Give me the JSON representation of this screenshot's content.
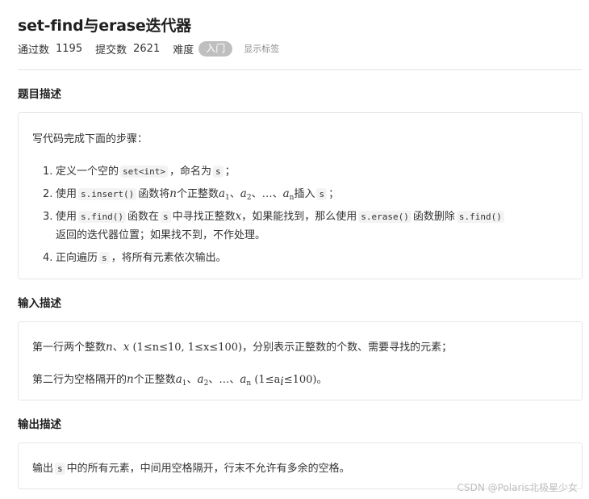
{
  "title": "set-find与erase迭代器",
  "meta": {
    "pass_label": "通过数",
    "pass_count": "1195",
    "submit_label": "提交数",
    "submit_count": "2621",
    "difficulty_label": "难度",
    "difficulty_value": "入门",
    "show_tags": "显示标签"
  },
  "sections": {
    "description": {
      "title": "题目描述",
      "intro": "写代码完成下面的步骤：",
      "step1": {
        "num": "1.",
        "a": "定义一个空的",
        "code": "set<int>",
        "b": "，命名为",
        "code2": "s",
        "c": "；"
      },
      "step2": {
        "num": "2.",
        "a": "使用",
        "code": "s.insert()",
        "b": "函数将",
        "var_n": "n",
        "c": "个正整数",
        "var_a": "a",
        "sub1": "1",
        "sep1": "、",
        "sub2": "2",
        "sep2": "、…、",
        "sub_n": "n",
        "d": "插入",
        "code2": "s",
        "e": "；"
      },
      "step3": {
        "num": "3.",
        "a": "使用",
        "code": "s.find()",
        "b": "函数在",
        "code2": "s",
        "c": "中寻找正整数",
        "var_x": "x",
        "d": "，如果能找到，那么使用",
        "code3": "s.erase()",
        "e": "函数删除",
        "code4": "s.find()",
        "line2": "返回的迭代器位置；如果找不到，不作处理。"
      },
      "step4": {
        "num": "4.",
        "a": "正向遍历",
        "code": "s",
        "b": "，将所有元素依次输出。"
      }
    },
    "input": {
      "title": "输入描述",
      "line1": {
        "a": "第一行两个整数",
        "var_n": "n",
        "sep": "、",
        "var_x": "x",
        "constraint": "(1≤n≤10, 1≤x≤100)",
        "b": "，分别表示正整数的个数、需要寻找的元素；"
      },
      "line2": {
        "a": "第二行为空格隔开的",
        "var_n": "n",
        "b": "个正整数",
        "var_a": "a",
        "sub1": "1",
        "sep1": "、",
        "sub2": "2",
        "sep2": "、…、",
        "sub_n": "n",
        "constraint": "(1≤a",
        "sub_i": "i",
        "constraint_end": "≤100)",
        "c": "。"
      }
    },
    "output": {
      "title": "输出描述",
      "a": "输出",
      "code": "s",
      "b": "中的所有元素，中间用空格隔开，行末不允许有多余的空格。"
    }
  },
  "watermark": "CSDN @Polaris北极星少女"
}
